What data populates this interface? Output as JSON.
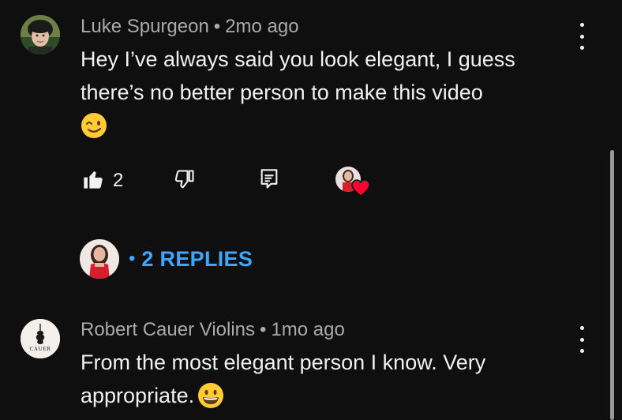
{
  "comments": [
    {
      "author": "Luke Spurgeon",
      "separator": "•",
      "time": "2mo ago",
      "text_line1": "Hey I’ve always said you look elegant, I guess",
      "text_line2": "there’s no better person to make this video",
      "emoji_icon": "winking-face-emoji",
      "likes": "2",
      "replies_label": "2 REPLIES",
      "replies_separator": "•"
    },
    {
      "author": "Robert Cauer Violins",
      "separator": "•",
      "time": "1mo ago",
      "text_line1": "From the most elegant person I know. Very",
      "text_line2": "appropriate.",
      "emoji_icon": "grinning-face-emoji",
      "avatar_logo_text": "CAUER"
    }
  ],
  "icons": {
    "like": "thumbs-up-icon",
    "dislike": "thumbs-down-icon",
    "reply": "reply-icon",
    "more": "more-vertical-icon",
    "creator_heart": "heart-icon"
  },
  "colors": {
    "background": "#0f0f0f",
    "text": "#f1f1f1",
    "meta": "#aaaaaa",
    "link": "#3ea6ff",
    "heart": "#ff0033"
  }
}
